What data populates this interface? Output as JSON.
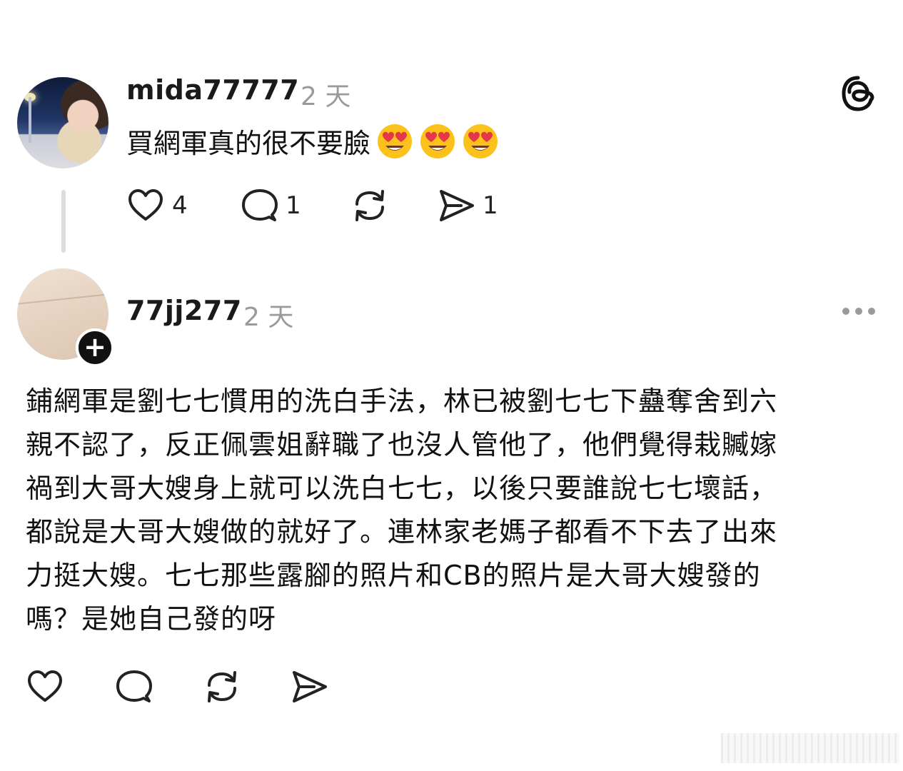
{
  "post1": {
    "username": "mida77777",
    "time": "2 天",
    "text": "買網軍真的很不要臉",
    "emojis": [
      "heart-eyes-emoji",
      "heart-eyes-emoji",
      "heart-eyes-emoji"
    ],
    "actions": {
      "likes": "4",
      "replies": "1",
      "reposts": "",
      "shares": "1"
    }
  },
  "post2": {
    "username": "77jj277",
    "time": "2 天",
    "follow_label": "+",
    "lines": [
      "鋪網軍是劉七七慣用的洗白手法，林已被劉七七下蠱奪舍到六",
      "親不認了，反正佩雲姐辭職了也沒人管他了，他們覺得栽贓嫁",
      "禍到大哥大嫂身上就可以洗白七七，以後只要誰說七七壞話，",
      "都說是大哥大嫂做的就好了。連林家老媽子都看不下去了出來",
      "力挺大嫂。七七那些露腳的照片和CB的照片是大哥大嫂發的",
      "嗎？是她自己發的呀"
    ]
  },
  "colors": {
    "text": "#111111",
    "muted": "#9a9a9a",
    "line": "#dcdcdc"
  },
  "icons": [
    "threads-logo-icon",
    "heart-icon",
    "comment-icon",
    "repost-icon",
    "send-icon",
    "more-icon"
  ]
}
